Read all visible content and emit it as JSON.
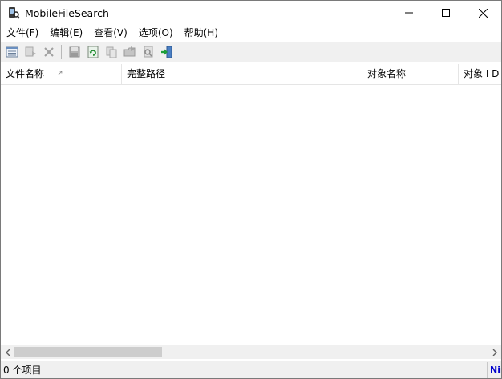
{
  "window": {
    "title": "MobileFileSearch"
  },
  "menu": [
    {
      "label": "文件(F)"
    },
    {
      "label": "编辑(E)"
    },
    {
      "label": "查看(V)"
    },
    {
      "label": "选项(O)"
    },
    {
      "label": "帮助(H)"
    }
  ],
  "toolbar": {
    "buttons": [
      {
        "icon": "properties-icon"
      },
      {
        "icon": "copy-file-icon"
      },
      {
        "icon": "delete-icon"
      },
      {
        "icon": "save-icon"
      },
      {
        "icon": "refresh-icon"
      },
      {
        "icon": "copy-icon"
      },
      {
        "icon": "open-folder-icon"
      },
      {
        "icon": "find-icon"
      },
      {
        "icon": "exit-icon"
      }
    ]
  },
  "list": {
    "columns": [
      {
        "label": "文件名称",
        "sort": "↗"
      },
      {
        "label": "完整路径"
      },
      {
        "label": "对象名称"
      },
      {
        "label": "对象 I D"
      }
    ]
  },
  "status": {
    "count": "0 个项目",
    "link": "NirSoft"
  },
  "colors": {
    "link": "#0000cc",
    "chrome": "#f0f0f0",
    "border": "#7a7a7a"
  }
}
